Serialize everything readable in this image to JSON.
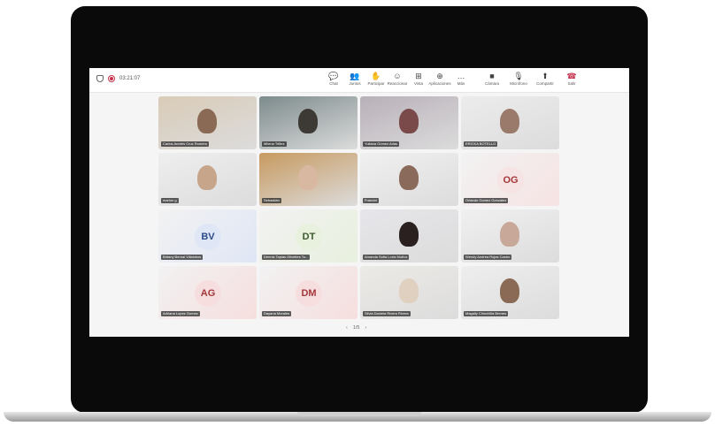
{
  "meeting": {
    "timer": "03:21:07"
  },
  "toolbar": [
    {
      "label": "Chat",
      "icon": "chat-icon",
      "glyph": "💬"
    },
    {
      "label": "Juntos",
      "icon": "people-icon",
      "glyph": "👥"
    },
    {
      "label": "Participar",
      "icon": "raise-hand-icon",
      "glyph": "✋"
    },
    {
      "label": "Reaccionar",
      "icon": "react-icon",
      "glyph": "☺"
    },
    {
      "label": "Vista",
      "icon": "view-icon",
      "glyph": "⊞"
    },
    {
      "label": "Aplicaciones",
      "icon": "apps-icon",
      "glyph": "⊕"
    },
    {
      "label": "Más",
      "icon": "more-icon",
      "glyph": "…"
    },
    {
      "label": "Cámara",
      "icon": "camera-icon",
      "glyph": "■"
    },
    {
      "label": "Micrófono",
      "icon": "microphone-icon",
      "glyph": "🎙"
    },
    {
      "label": "Compartir",
      "icon": "share-icon",
      "glyph": "⬆"
    },
    {
      "label": "Salir",
      "icon": "leave-icon",
      "glyph": "☎"
    }
  ],
  "participants": [
    {
      "name": "Carlos Andrés Cruz Romero",
      "type": "video"
    },
    {
      "name": "Milena Téllez",
      "type": "video"
    },
    {
      "name": "Yuliana Gómez Arias",
      "type": "video"
    },
    {
      "name": "ERICKA BOTELLO",
      "type": "video"
    },
    {
      "name": "marlon g",
      "type": "video"
    },
    {
      "name": "Sebastián",
      "type": "video"
    },
    {
      "name": "Francini",
      "type": "video"
    },
    {
      "name": "Orlando Gomez Gonzalez",
      "type": "avatar",
      "initials": "OG",
      "bg": "#f6e3e3",
      "color": "#a4373a"
    },
    {
      "name": "Britany Bernal Villalobos",
      "type": "avatar",
      "initials": "BV",
      "bg": "#dfe6f5",
      "color": "#2b4a8a"
    },
    {
      "name": "Dennis Tapias Olivettes To...",
      "type": "avatar",
      "initials": "DT",
      "bg": "#e8f0de",
      "color": "#3b5a2b"
    },
    {
      "name": "Amanda Sofia Loría Muñoz",
      "type": "video"
    },
    {
      "name": "Wendy Andrea Rojas Castro",
      "type": "video"
    },
    {
      "name": "Adriana Lopez Gomez",
      "type": "avatar",
      "initials": "AG",
      "bg": "#f6dede",
      "color": "#a4373a"
    },
    {
      "name": "Dayana Morales",
      "type": "avatar",
      "initials": "DM",
      "bg": "#f6dede",
      "color": "#a4373a"
    },
    {
      "name": "Silvia Daniela Rivera Rivera",
      "type": "video"
    },
    {
      "name": "Magally Chinchilla Brenes",
      "type": "video"
    }
  ],
  "pager": {
    "prev": "‹",
    "page": "1/5",
    "next": "›"
  }
}
